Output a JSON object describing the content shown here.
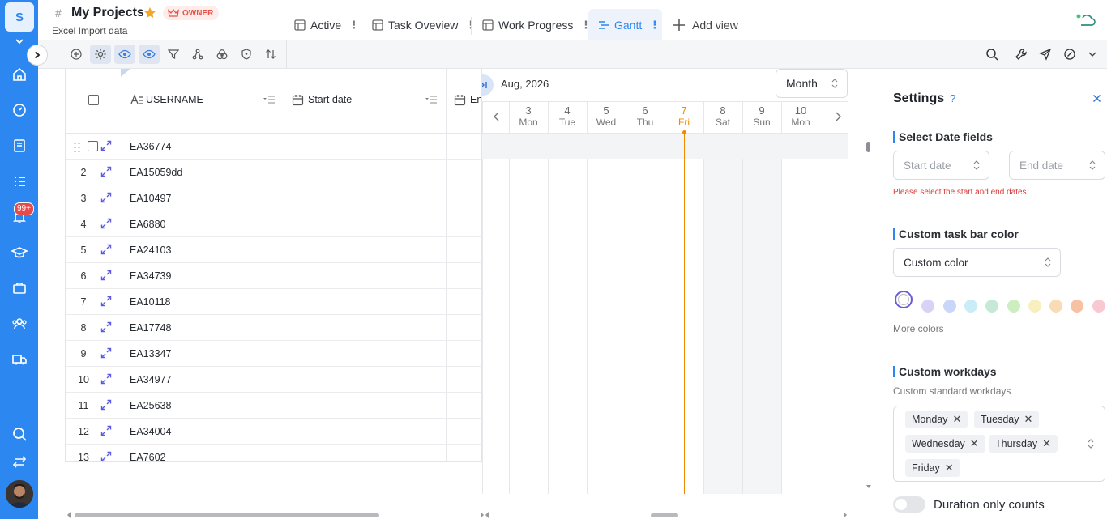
{
  "app": {
    "logo_letter": "S",
    "notifications_badge": "99+"
  },
  "header": {
    "hash": "#",
    "title": "My Projects",
    "owner_badge": "OWNER",
    "subtitle": "Excel Import data"
  },
  "views": {
    "tabs": [
      {
        "label": "Active",
        "icon": "table-icon",
        "active": false
      },
      {
        "label": "Task Oveview",
        "icon": "table-icon",
        "active": false
      },
      {
        "label": "Work Progress",
        "icon": "table-icon",
        "active": false
      },
      {
        "label": "Gantt",
        "icon": "gantt-icon",
        "active": true
      }
    ],
    "add_view": "Add view"
  },
  "grid": {
    "columns": {
      "username": "USERNAME",
      "start_date": "Start date",
      "end_date": "En"
    },
    "rows": [
      {
        "num": "",
        "username": "EA36774"
      },
      {
        "num": "2",
        "username": "EA15059dd"
      },
      {
        "num": "3",
        "username": "EA10497"
      },
      {
        "num": "4",
        "username": "EA6880"
      },
      {
        "num": "5",
        "username": "EA24103"
      },
      {
        "num": "6",
        "username": "EA34739"
      },
      {
        "num": "7",
        "username": "EA10118"
      },
      {
        "num": "8",
        "username": "EA17748"
      },
      {
        "num": "9",
        "username": "EA13347"
      },
      {
        "num": "10",
        "username": "EA34977"
      },
      {
        "num": "11",
        "username": "EA25638"
      },
      {
        "num": "12",
        "username": "EA34004"
      },
      {
        "num": "13",
        "username": "EA7602"
      }
    ]
  },
  "gantt": {
    "month_label": "Aug, 2026",
    "scale": "Month",
    "days": [
      {
        "num": "3",
        "name": "Mon",
        "today": false
      },
      {
        "num": "4",
        "name": "Tue",
        "today": false
      },
      {
        "num": "5",
        "name": "Wed",
        "today": false
      },
      {
        "num": "6",
        "name": "Thu",
        "today": false
      },
      {
        "num": "7",
        "name": "Fri",
        "today": true
      },
      {
        "num": "8",
        "name": "Sat",
        "today": false
      },
      {
        "num": "9",
        "name": "Sun",
        "today": false
      },
      {
        "num": "10",
        "name": "Mon",
        "today": false
      }
    ]
  },
  "settings": {
    "title": "Settings",
    "help": "?",
    "date_fields": {
      "label": "Select Date fields",
      "start_placeholder": "Start date",
      "end_placeholder": "End date",
      "error": "Please select the start and end dates"
    },
    "bar_color": {
      "label": "Custom task bar color",
      "value": "Custom color",
      "swatches": [
        "#ffffff",
        "#d9d2f7",
        "#c9d6f7",
        "#c9ecf8",
        "#c6e9d7",
        "#cdeec1",
        "#f8efbf",
        "#f9dbb6",
        "#f7c2a3",
        "#f8c9d2"
      ],
      "more": "More colors"
    },
    "workdays": {
      "label": "Custom workdays",
      "sublabel": "Custom standard workdays",
      "days": [
        "Monday",
        "Tuesday",
        "Wednesday",
        "Thursday",
        "Friday"
      ]
    },
    "duration_toggle": "Duration only counts"
  },
  "colors": {
    "accent": "#2c87f0",
    "today": "#f08a00",
    "error": "#d93a3a"
  }
}
